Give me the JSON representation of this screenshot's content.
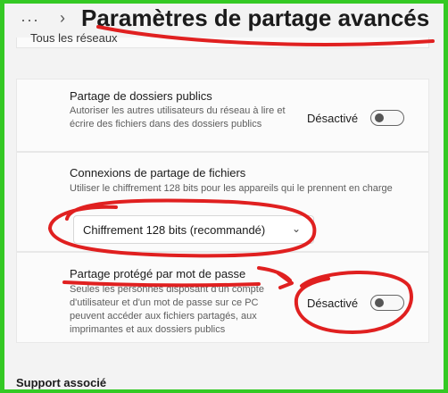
{
  "header": {
    "more_glyph": "···",
    "chevron_glyph": "›",
    "title": "Paramètres de partage avancés"
  },
  "sections": {
    "top_label": "Tous les réseaux"
  },
  "rows": [
    {
      "title": "Partage de dossiers publics",
      "description": "Autoriser les autres utilisateurs du réseau à lire et écrire des fichiers dans des dossiers publics",
      "toggle_label": "Désactivé",
      "toggle_on": false
    },
    {
      "title": "Connexions de partage de fichiers",
      "description": "Utiliser le chiffrement 128 bits pour les appareils qui le prennent en charge",
      "select_value": "Chiffrement 128 bits (recommandé)"
    },
    {
      "title": "Partage protégé par mot de passe",
      "description": "Seules les personnes disposant d'un compte d'utilisateur et d'un mot de passe sur ce PC peuvent accéder aux fichiers partagés, aux imprimantes et aux dossiers publics",
      "toggle_label": "Désactivé",
      "toggle_on": false
    }
  ],
  "footer": {
    "support_label": "Support associé"
  },
  "annotation": {
    "color": "#e02020"
  }
}
